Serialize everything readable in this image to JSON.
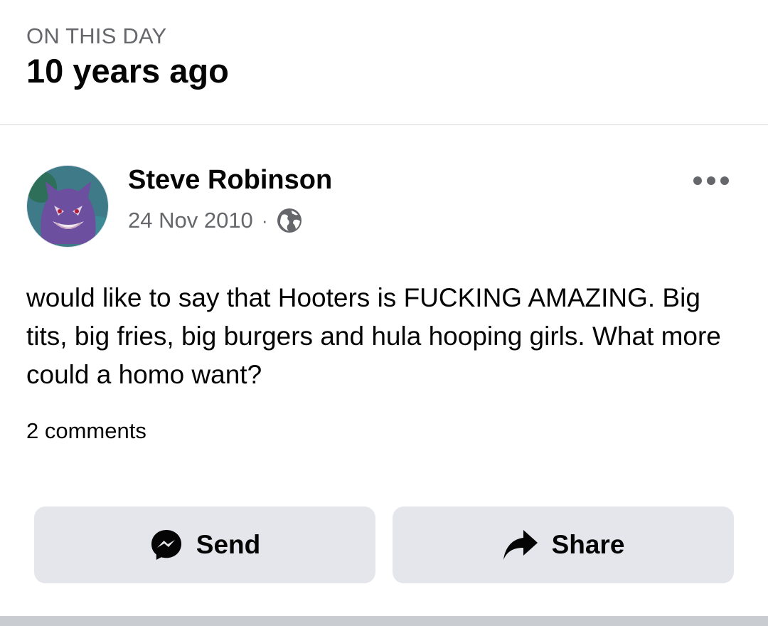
{
  "header": {
    "eyebrow": "ON THIS DAY",
    "title": "10 years ago"
  },
  "post": {
    "author": "Steve Robinson",
    "date": "24 Nov 2010",
    "separator": "·",
    "privacy_icon": "globe-icon",
    "more_icon": "more-options-icon",
    "avatar_icon": "ghost-character-avatar",
    "text": "would like to say that Hooters is FUCKING AMAZING. Big tits, big fries, big burgers and hula hooping girls. What more could a homo want?",
    "comments_label": "2 comments"
  },
  "actions": {
    "send_label": "Send",
    "send_icon": "messenger-icon",
    "share_label": "Share",
    "share_icon": "share-arrow-icon"
  },
  "colors": {
    "text_primary": "#050505",
    "text_secondary": "#65676b",
    "button_bg": "#e4e6eb",
    "divider": "#d6d7da"
  }
}
